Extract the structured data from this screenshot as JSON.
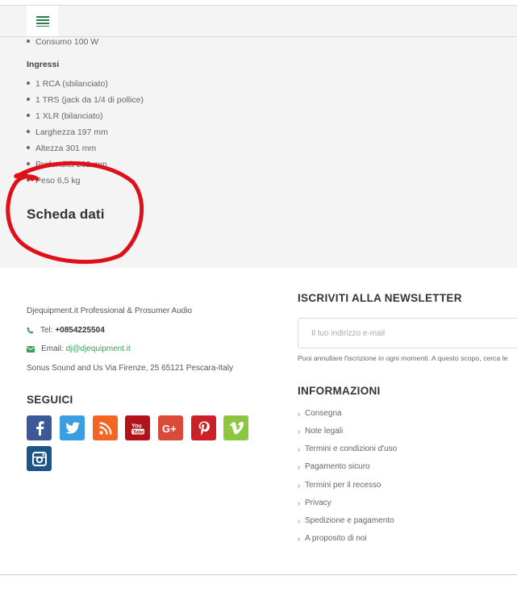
{
  "header": {
    "menu_icon": "hamburger-menu-icon"
  },
  "specs": {
    "top_item": "Consumo 100 W",
    "inputs_heading": "Ingressi",
    "items": [
      "1 RCA (sbilanciato)",
      "1 TRS (jack da 1/4 di pollice)",
      "1 XLR (bilanciato)",
      "Larghezza 197 mm",
      "Altezza 301 mm",
      "Profondità 262 mm",
      "Peso 6,5 kg"
    ],
    "datasheet_title": "Scheda dati",
    "annotation_color": "#e0101a"
  },
  "footer": {
    "company": "Djequipment.it Professional & Prosumer Audio",
    "tel_label": "Tel:",
    "tel_value": "+0854225504",
    "email_label": "Email:",
    "email_value": "dj@djequipment.it",
    "address": "Sonus Sound and Us Via Firenze, 25 65121 Pescara-Italy",
    "follow_heading": "SEGUICI",
    "social": [
      {
        "name": "facebook-icon",
        "color": "#3b5998"
      },
      {
        "name": "twitter-icon",
        "color": "#3a9fe0"
      },
      {
        "name": "rss-icon",
        "color": "#f26522"
      },
      {
        "name": "youtube-icon",
        "color": "#b3121b"
      },
      {
        "name": "google-plus-icon",
        "color": "#d94a38"
      },
      {
        "name": "pinterest-icon",
        "color": "#cb2027"
      },
      {
        "name": "vimeo-icon",
        "color": "#8dc63f"
      },
      {
        "name": "instagram-icon",
        "color": "#1c5587"
      }
    ],
    "newsletter_heading": "ISCRIVITI ALLA NEWSLETTER",
    "newsletter_placeholder": "Il tuo indirizzo e-mail",
    "newsletter_note": "Puoi annullare l'iscrizione in ogni momenti. A questo scopo, cerca le",
    "info_heading": "INFORMAZIONI",
    "info_links": [
      "Consegna",
      "Note legali",
      "Termini e condizioni d'uso",
      "Pagamento sicuro",
      "Termini per il recesso",
      "Privacy",
      "Spedizione e pagamento",
      "A proposito di noi"
    ],
    "accent_color": "#3aa15a"
  }
}
